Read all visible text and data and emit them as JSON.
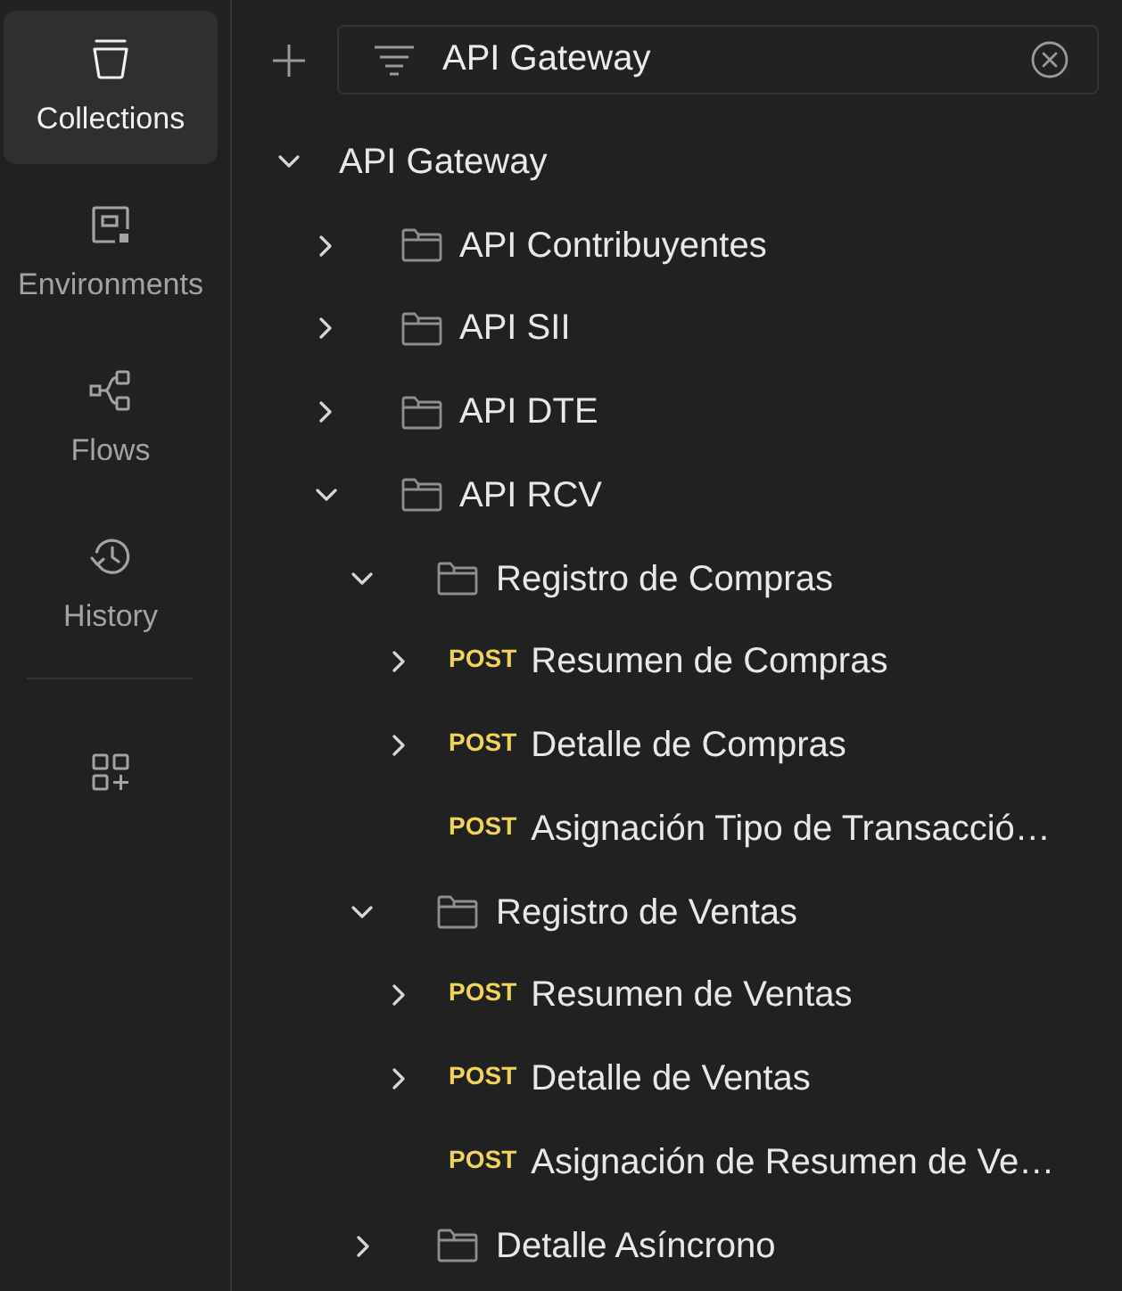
{
  "sidebar": {
    "items": [
      {
        "label": "Collections",
        "selected": true
      },
      {
        "label": "Environments",
        "selected": false
      },
      {
        "label": "Flows",
        "selected": false
      },
      {
        "label": "History",
        "selected": false
      }
    ]
  },
  "search": {
    "value": "API Gateway"
  },
  "tree": [
    {
      "kind": "collection",
      "label": "API Gateway",
      "expanded": true,
      "children": [
        {
          "kind": "folder",
          "label": "API Contribuyentes",
          "expanded": false
        },
        {
          "kind": "folder",
          "label": "API SII",
          "expanded": false
        },
        {
          "kind": "folder",
          "label": "API DTE",
          "expanded": false
        },
        {
          "kind": "folder",
          "label": "API RCV",
          "expanded": true,
          "children": [
            {
              "kind": "folder",
              "label": "Registro de Compras",
              "expanded": true,
              "children": [
                {
                  "kind": "request",
                  "method": "POST",
                  "label": "Resumen de Compras",
                  "expandable": true,
                  "expanded": false
                },
                {
                  "kind": "request",
                  "method": "POST",
                  "label": "Detalle de Compras",
                  "expandable": true,
                  "expanded": false
                },
                {
                  "kind": "request",
                  "method": "POST",
                  "label": "Asignación Tipo de Transacció…",
                  "expandable": false
                }
              ]
            },
            {
              "kind": "folder",
              "label": "Registro de Ventas",
              "expanded": true,
              "children": [
                {
                  "kind": "request",
                  "method": "POST",
                  "label": "Resumen de Ventas",
                  "expandable": true,
                  "expanded": false
                },
                {
                  "kind": "request",
                  "method": "POST",
                  "label": "Detalle de Ventas",
                  "expandable": true,
                  "expanded": false
                },
                {
                  "kind": "request",
                  "method": "POST",
                  "label": "Asignación de Resumen de Ve…",
                  "expandable": false
                }
              ]
            },
            {
              "kind": "folder",
              "label": "Detalle Asíncrono",
              "expanded": false
            }
          ]
        }
      ]
    }
  ]
}
